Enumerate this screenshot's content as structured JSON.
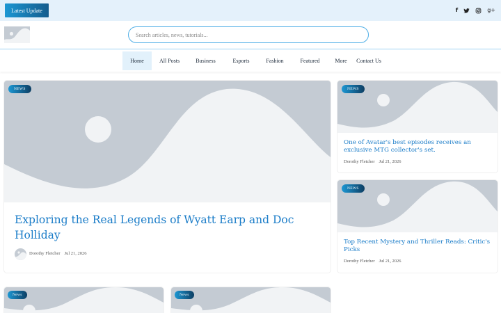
{
  "topbar": {
    "latest_label": "Latest Update",
    "social": [
      {
        "icon": "facebook-icon",
        "glyph": "f"
      },
      {
        "icon": "twitter-icon",
        "glyph": ""
      },
      {
        "icon": "instagram-icon",
        "glyph": ""
      },
      {
        "icon": "google-plus-icon",
        "glyph": "g+"
      }
    ]
  },
  "header": {
    "logo_icon": "image-placeholder-icon",
    "search_placeholder": "Search articles, news, tutorials..."
  },
  "nav": {
    "items": [
      {
        "label": "Home",
        "active": true
      },
      {
        "label": "All Posts"
      },
      {
        "label": "Business"
      },
      {
        "label": "Esports"
      },
      {
        "label": "Fashion"
      },
      {
        "label": "Featured"
      },
      {
        "label": "More"
      },
      {
        "label": "Contact Us"
      }
    ]
  },
  "featured": {
    "badge": "NEWS",
    "title": "Exploring the Real Legends of Wyatt Earp and Doc Holliday",
    "author": "Dorothy Fletcher",
    "date": "Jul 21, 2026"
  },
  "side_posts": [
    {
      "badge": "NEWS",
      "title": "One of Avatar's best episodes receives an exclusive MTG collector's set.",
      "author": "Dorothy Fletcher",
      "date": "Jul 21, 2026"
    },
    {
      "badge": "NEWS",
      "title": "Top Recent Mystery and Thriller Reads: Critic's Picks",
      "author": "Dorothy Fletcher",
      "date": "Jul 21, 2026"
    }
  ],
  "bottom_posts": [
    {
      "badge": "News"
    },
    {
      "badge": "News"
    }
  ],
  "colors": {
    "accent": "#1a7cc8",
    "placeholder_bg": "#c4cbd3",
    "placeholder_shape": "#f1f3f5",
    "topbar_bg": "#e4f1fb"
  }
}
